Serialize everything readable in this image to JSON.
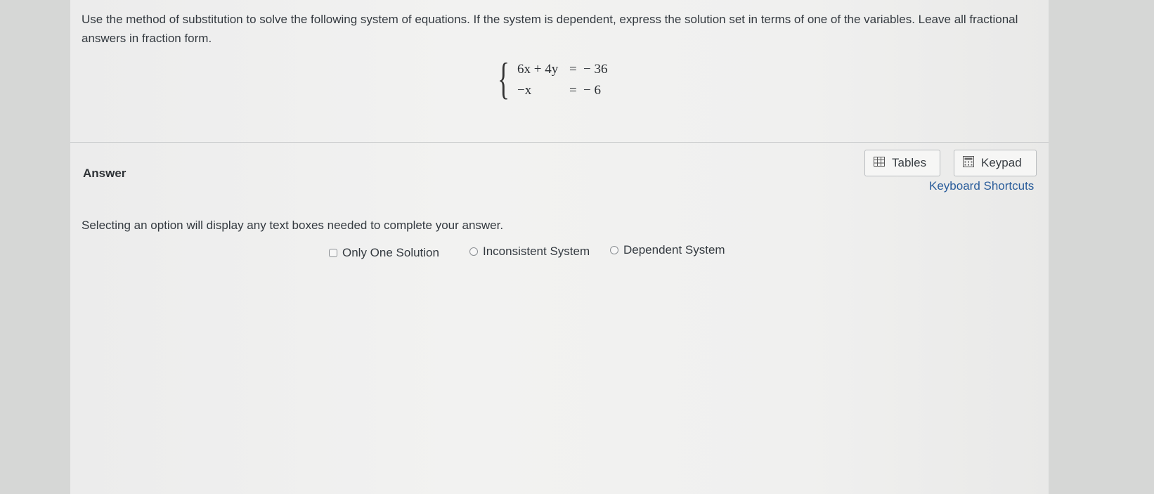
{
  "question": {
    "text": "Use the method of substitution to solve the following system of equations. If the system is dependent, express the solution set in terms of one of the variables. Leave all fractional answers in fraction form.",
    "equations": [
      {
        "lhs": "6x + 4y",
        "sign": "=",
        "rhs": "− 36"
      },
      {
        "lhs": "−x",
        "sign": "=",
        "rhs": "− 6"
      }
    ]
  },
  "answer": {
    "title": "Answer",
    "tables_label": "Tables",
    "keypad_label": "Keypad",
    "shortcuts_label": "Keyboard Shortcuts",
    "instruction": "Selecting an option will display any text boxes needed to complete your answer.",
    "options": [
      "Only One Solution",
      "Inconsistent System",
      "Dependent System"
    ]
  },
  "icons": {
    "tables": "table-grid-icon",
    "keypad": "calculator-icon",
    "option": "radio-icon"
  },
  "colors": {
    "link": "#2a5d9b",
    "text": "#343a40"
  }
}
